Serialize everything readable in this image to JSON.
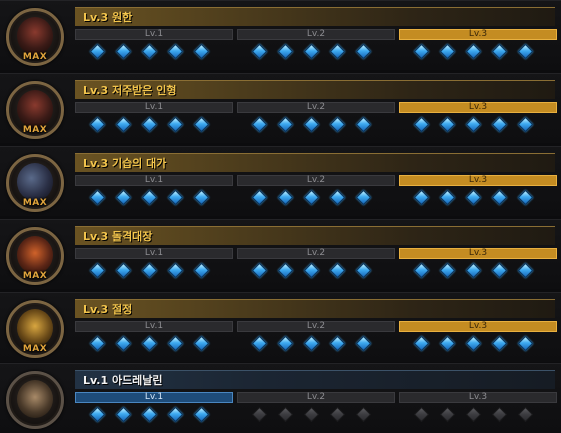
{
  "max_label": "MAX",
  "level_labels": [
    "Lv.1",
    "Lv.2",
    "Lv.3"
  ],
  "colors": {
    "accent_gold": "#f2c44c",
    "active_level": "#c48c22",
    "current_blue": "#1e4c7a",
    "gem": "#3eaaf0"
  },
  "skills": [
    {
      "title": "Lv.3 원한",
      "icon": "skull-portrait-icon",
      "maxed": true,
      "level": 3,
      "gems_filled": 15
    },
    {
      "title": "Lv.3 저주받은 인형",
      "icon": "cursed-doll-portrait-icon",
      "maxed": true,
      "level": 3,
      "gems_filled": 15
    },
    {
      "title": "Lv.3 기습의 대가",
      "icon": "crescent-moon-portrait-icon",
      "maxed": true,
      "level": 3,
      "gems_filled": 15
    },
    {
      "title": "Lv.3 돌격대장",
      "icon": "flaming-warrior-portrait-icon",
      "maxed": true,
      "level": 3,
      "gems_filled": 15
    },
    {
      "title": "Lv.3 절정",
      "icon": "golden-strike-portrait-icon",
      "maxed": true,
      "level": 3,
      "gems_filled": 15
    },
    {
      "title": "Lv.1 아드레날린",
      "icon": "running-figure-portrait-icon",
      "maxed": false,
      "level": 1,
      "gems_filled": 5
    }
  ]
}
